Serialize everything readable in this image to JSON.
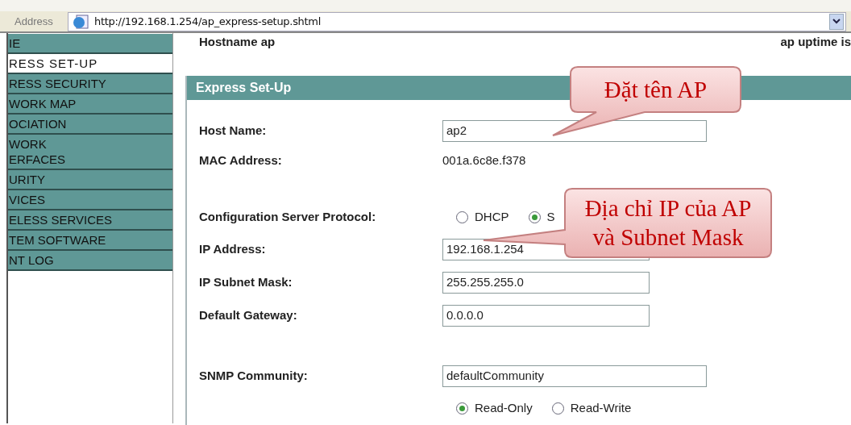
{
  "address_bar": {
    "label": "Address",
    "url": "http://192.168.1.254/ap_express-setup.shtml"
  },
  "sidebar": {
    "items": [
      {
        "label": "IE",
        "selected": false
      },
      {
        "label": "RESS SET-UP",
        "selected": true
      },
      {
        "label": "RESS SECURITY",
        "selected": false
      },
      {
        "label": "WORK MAP",
        "selected": false
      },
      {
        "label": "OCIATION",
        "selected": false
      },
      {
        "label": "WORK\nERFACES",
        "selected": false
      },
      {
        "label": "URITY",
        "selected": false
      },
      {
        "label": "VICES",
        "selected": false
      },
      {
        "label": "ELESS SERVICES",
        "selected": false
      },
      {
        "label": "TEM SOFTWARE",
        "selected": false
      },
      {
        "label": "NT LOG",
        "selected": false
      }
    ]
  },
  "header": {
    "hostname": "Hostname ap",
    "uptime": "ap uptime is"
  },
  "panel": {
    "title": "Express Set-Up",
    "rows": [
      {
        "kind": "input",
        "label": "Host Name:",
        "value": "ap2",
        "wide": true
      },
      {
        "kind": "text",
        "label": "MAC Address:",
        "value": "001a.6c8e.f378"
      },
      {
        "kind": "gap"
      },
      {
        "kind": "radio",
        "label": "Configuration Server Protocol:",
        "options": [
          {
            "label": "DHCP",
            "selected": false
          },
          {
            "label": "S",
            "selected": true
          }
        ]
      },
      {
        "kind": "input",
        "label": "IP Address:",
        "value": "192.168.1.254",
        "wide": false
      },
      {
        "kind": "input",
        "label": "IP Subnet Mask:",
        "value": "255.255.255.0",
        "wide": false
      },
      {
        "kind": "input",
        "label": "Default Gateway:",
        "value": "0.0.0.0",
        "wide": false
      },
      {
        "kind": "gap"
      },
      {
        "kind": "input",
        "label": "SNMP Community:",
        "value": "defaultCommunity",
        "wide": true
      },
      {
        "kind": "radio",
        "label": "",
        "options": [
          {
            "label": "Read-Only",
            "selected": true
          },
          {
            "label": "Read-Write",
            "selected": false
          }
        ]
      }
    ]
  },
  "callouts": [
    {
      "text": "Đặt tên AP"
    },
    {
      "text": "Địa chỉ IP của AP\nvà Subnet Mask"
    }
  ]
}
